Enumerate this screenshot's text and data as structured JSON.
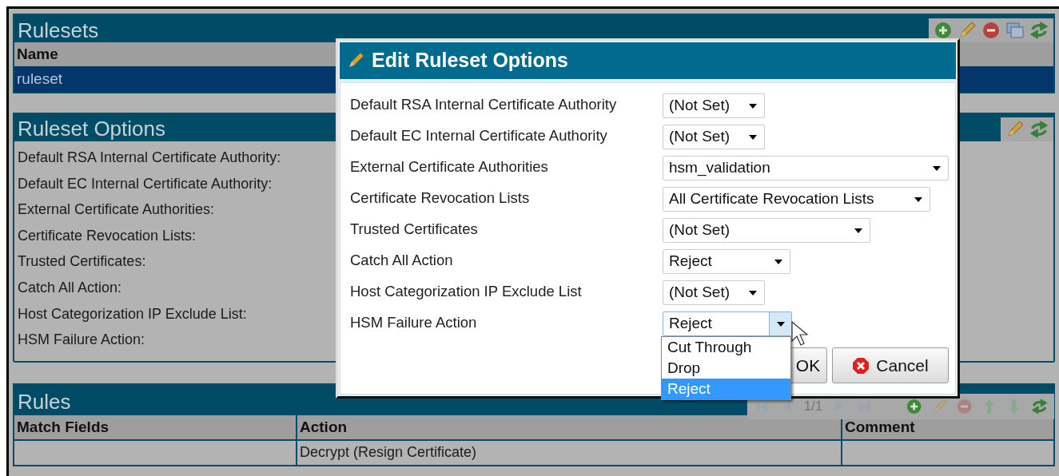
{
  "rulesets": {
    "title": "Rulesets",
    "toolbar": [
      {
        "kind": "add",
        "disabled": false
      },
      {
        "kind": "edit",
        "disabled": false
      },
      {
        "kind": "delete",
        "disabled": false
      },
      {
        "kind": "windows",
        "disabled": false
      },
      {
        "kind": "refresh",
        "disabled": false
      }
    ],
    "column": "Name",
    "rows": [
      {
        "name": "ruleset",
        "selected": true
      }
    ]
  },
  "ruleset_options": {
    "title": "Ruleset Options",
    "toolbar": [
      {
        "kind": "edit",
        "disabled": false
      },
      {
        "kind": "refresh",
        "disabled": false
      }
    ],
    "labels": [
      "Default RSA Internal Certificate Authority:",
      "Default EC Internal Certificate Authority:",
      "External Certificate Authorities:",
      "Certificate Revocation Lists:",
      "Trusted Certificates:",
      "Catch All Action:",
      "Host Categorization IP Exclude List:",
      "HSM Failure Action:"
    ]
  },
  "rules": {
    "title": "Rules",
    "pager": "1/1",
    "toolbar": [
      {
        "kind": "first",
        "disabled": true
      },
      {
        "kind": "prev",
        "disabled": true
      },
      {
        "kind": "next",
        "disabled": true
      },
      {
        "kind": "last",
        "disabled": true
      },
      {
        "kind": "add",
        "disabled": false
      },
      {
        "kind": "edit",
        "disabled": true
      },
      {
        "kind": "delete",
        "disabled": true
      },
      {
        "kind": "up",
        "disabled": true
      },
      {
        "kind": "down",
        "disabled": true
      },
      {
        "kind": "refresh",
        "disabled": false
      }
    ],
    "columns": [
      "Match Fields",
      "Action",
      "Comment"
    ],
    "rows": [
      {
        "action": "Decrypt (Resign Certificate)"
      }
    ]
  },
  "dialog": {
    "title": "Edit Ruleset Options",
    "fields": [
      {
        "label": "Default RSA Internal Certificate Authority",
        "value": "(Not Set)",
        "open": false
      },
      {
        "label": "Default EC Internal Certificate Authority",
        "value": "(Not Set)",
        "open": false
      },
      {
        "label": "External Certificate Authorities",
        "value": "hsm_validation",
        "open": false
      },
      {
        "label": "Certificate Revocation Lists",
        "value": "All Certificate Revocation Lists",
        "open": false
      },
      {
        "label": "Trusted Certificates",
        "value": "(Not Set)",
        "open": false
      },
      {
        "label": "Catch All Action",
        "value": "Reject",
        "open": false
      },
      {
        "label": "Host Categorization IP Exclude List",
        "value": "(Not Set)",
        "open": false
      },
      {
        "label": "HSM Failure Action",
        "value": "Reject",
        "open": true
      }
    ],
    "options": [
      {
        "label": "Cut Through",
        "selected": false
      },
      {
        "label": "Drop",
        "selected": false
      },
      {
        "label": "Reject",
        "selected": true
      }
    ],
    "buttons": [
      {
        "label": "OK",
        "kind": "ok"
      },
      {
        "label": "Cancel",
        "kind": "cancel"
      }
    ]
  }
}
